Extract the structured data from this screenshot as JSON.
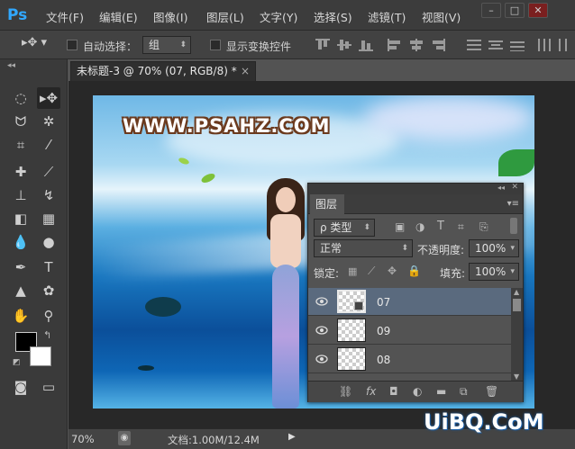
{
  "app": {
    "logo": "Ps"
  },
  "menu": [
    "文件(F)",
    "编辑(E)",
    "图像(I)",
    "图层(L)",
    "文字(Y)",
    "选择(S)",
    "滤镜(T)",
    "视图(V)"
  ],
  "window_controls": [
    "minimize-icon",
    "restore-icon",
    "close-icon"
  ],
  "options": {
    "auto_select_label": "自动选择：",
    "auto_select_value": "组",
    "show_transform_label": "显示变换控件"
  },
  "document": {
    "tab_title": "未标题-3 @ 70% (07, RGB/8) *",
    "close_glyph": "×",
    "watermark_text": "WWW.PSAHZ.COM"
  },
  "status": {
    "zoom": "70%",
    "doc_info": "文档:1.00M/12.4M"
  },
  "layers_panel": {
    "tab_label": "图层",
    "filter_label": "ρ 类型",
    "blend_mode": "正常",
    "opacity_label": "不透明度:",
    "opacity_value": "100%",
    "lock_label": "锁定:",
    "fill_label": "填充:",
    "fill_value": "100%",
    "layers": [
      {
        "name": "07",
        "visible": true,
        "selected": true
      },
      {
        "name": "09",
        "visible": true,
        "selected": false
      },
      {
        "name": "08",
        "visible": true,
        "selected": false
      }
    ],
    "bottom_fx": "fx"
  },
  "colors": {
    "foreground": "#000000",
    "background": "#ffffff",
    "accent": "#31a8ff"
  },
  "footer_watermark": "UiBQ.CoM"
}
